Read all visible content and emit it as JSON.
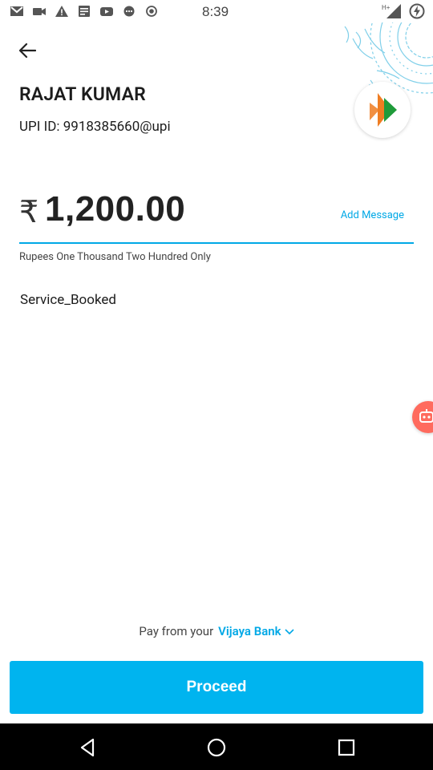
{
  "status_bar": {
    "time": "8:39",
    "icons": [
      "gmail-icon",
      "video-icon",
      "warning-icon",
      "news-icon",
      "youtube-icon",
      "chat-icon",
      "record-icon"
    ],
    "right_icons": [
      "network-h-plus-icon",
      "signal-icon",
      "battery-charging-icon"
    ],
    "network_label": "H+"
  },
  "payee": {
    "name": "RAJAT KUMAR",
    "upi_label": "UPI ID:",
    "upi_id": "9918385660@upi"
  },
  "amount": {
    "currency_symbol": "₹",
    "value": "1,200.00",
    "add_message_label": "Add Message",
    "in_words": "Rupees One Thousand Two Hundred Only"
  },
  "remarks": "Service_Booked",
  "pay_from": {
    "prefix": "Pay from your",
    "bank": "Vijaya Bank"
  },
  "proceed_label": "Proceed",
  "colors": {
    "accent": "#00b4ef",
    "link": "#00a8e6",
    "float_button": "#ff6b5e"
  }
}
